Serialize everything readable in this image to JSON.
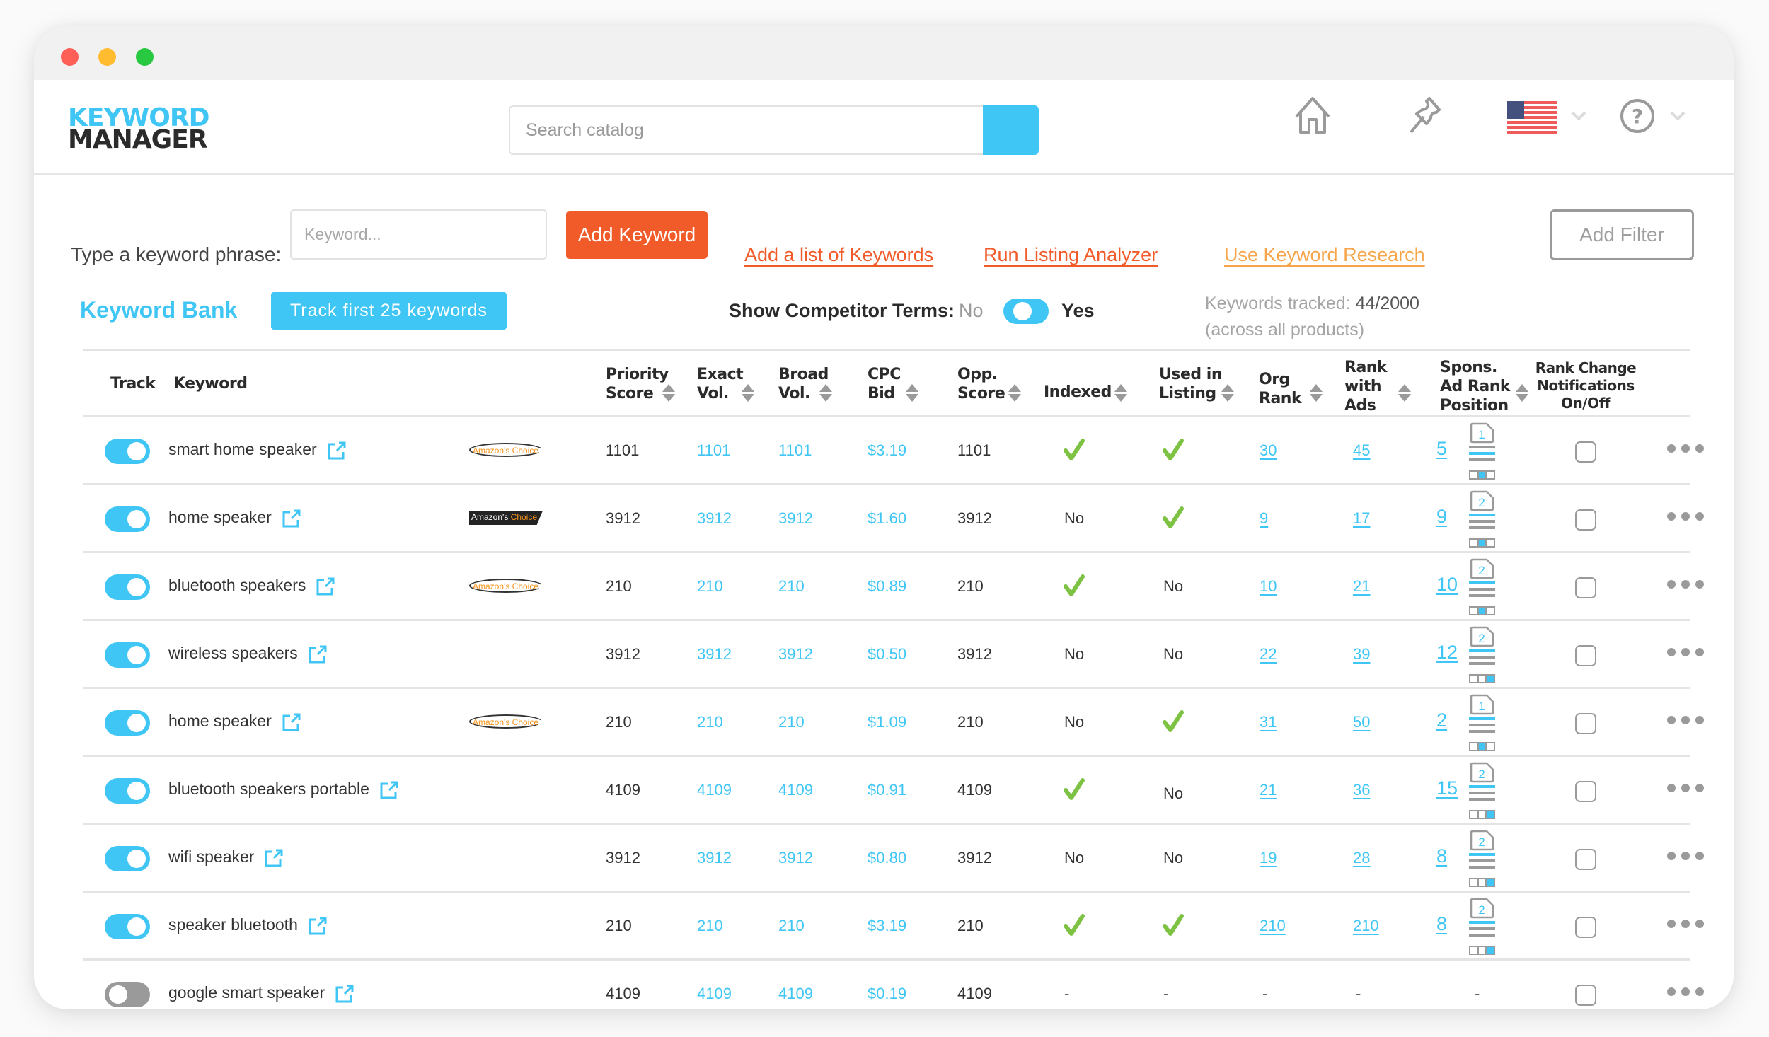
{
  "window": {
    "controls": [
      "close",
      "minimize",
      "maximize"
    ]
  },
  "header": {
    "logo_line1": "KEYWORD",
    "logo_line2": "MANAGER",
    "search_placeholder": "Search catalog",
    "icons": [
      "home-icon",
      "pin-icon",
      "us-flag-icon",
      "chevron-down-icon",
      "help-icon",
      "chevron-down-icon"
    ],
    "marketplace": "US"
  },
  "controls": {
    "keyword_phrase_label": "Type a keyword phrase:",
    "keyword_placeholder": "Keyword...",
    "add_keyword": "Add Keyword",
    "add_list": "Add a list of Keywords",
    "run_analyzer": "Run Listing Analyzer",
    "use_research": "Use Keyword Research",
    "add_filter": "Add Filter"
  },
  "bank": {
    "title": "Keyword Bank",
    "track_first": "Track first 25 keywords",
    "competitor_label": "Show Competitor Terms:",
    "competitor_no": "No",
    "competitor_yes": "Yes",
    "competitor_on": true,
    "tracked_label": "Keywords tracked:",
    "tracked_value": "44/2000",
    "tracked_note": "(across all products)"
  },
  "colors": {
    "accent": "#3fc6f4",
    "orange": "#f15a29",
    "check": "#7dc243",
    "muted": "#9a9a9a"
  },
  "table": {
    "headers": {
      "track": "Track",
      "keyword": "Keyword",
      "priority": [
        "Priority",
        "Score"
      ],
      "exact": [
        "Exact",
        "Vol."
      ],
      "broad": [
        "Broad",
        "Vol."
      ],
      "cpc": [
        "CPC",
        "Bid"
      ],
      "opp": [
        "Opp.",
        "Score"
      ],
      "indexed": "Indexed",
      "used": [
        "Used in",
        "Listing"
      ],
      "org": [
        "Org",
        "Rank"
      ],
      "rank_ads": [
        "Rank",
        "with",
        "Ads"
      ],
      "spons": [
        "Spons.",
        "Ad Rank",
        "Position"
      ],
      "notif": [
        "Rank Change",
        "Notifications",
        "On/Off"
      ]
    },
    "rows": [
      {
        "tracked": true,
        "keyword": "smart home speaker",
        "badge": "light",
        "priority": "1101",
        "exact": "1101",
        "broad": "1101",
        "cpc": "$3.19",
        "opp": "1101",
        "indexed": "check",
        "used": "check",
        "org": "30",
        "rank_ads": "45",
        "spons": "5",
        "ad_page": "1",
        "ad_line": 2,
        "ad_box": 2,
        "notify": false
      },
      {
        "tracked": true,
        "keyword": "home speaker",
        "badge": "dark",
        "priority": "3912",
        "exact": "3912",
        "broad": "3912",
        "cpc": "$1.60",
        "opp": "3912",
        "indexed": "No",
        "used": "check",
        "org": "9",
        "rank_ads": "17",
        "spons": "9",
        "ad_page": "2",
        "ad_line": 1,
        "ad_box": 2,
        "notify": false
      },
      {
        "tracked": true,
        "keyword": "bluetooth speakers",
        "badge": "light",
        "priority": "210",
        "exact": "210",
        "broad": "210",
        "cpc": "$0.89",
        "opp": "210",
        "indexed": "check",
        "used": "No",
        "org": "10",
        "rank_ads": "21",
        "spons": "10",
        "ad_page": "2",
        "ad_line": 1,
        "ad_box": 2,
        "notify": false
      },
      {
        "tracked": true,
        "keyword": "wireless speakers",
        "badge": "",
        "priority": "3912",
        "exact": "3912",
        "broad": "3912",
        "cpc": "$0.50",
        "opp": "3912",
        "indexed": "No",
        "used": "No",
        "org": "22",
        "rank_ads": "39",
        "spons": "12",
        "ad_page": "2",
        "ad_line": 1,
        "ad_box": 3,
        "notify": false
      },
      {
        "tracked": true,
        "keyword": "home speaker",
        "badge": "light",
        "priority": "210",
        "exact": "210",
        "broad": "210",
        "cpc": "$1.09",
        "opp": "210",
        "indexed": "No",
        "used": "check",
        "org": "31",
        "rank_ads": "50",
        "spons": "2",
        "ad_page": "1",
        "ad_line": 1,
        "ad_box": 2,
        "notify": false
      },
      {
        "tracked": true,
        "keyword": "bluetooth speakers portable",
        "badge": "",
        "priority": "4109",
        "exact": "4109",
        "broad": "4109",
        "cpc": "$0.91",
        "opp": "4109",
        "indexed": "check",
        "used": "No",
        "org": "21",
        "rank_ads": "36",
        "spons": "15",
        "ad_page": "2",
        "ad_line": 1,
        "ad_box": 3,
        "notify": false
      },
      {
        "tracked": true,
        "keyword": "wifi speaker",
        "badge": "",
        "priority": "3912",
        "exact": "3912",
        "broad": "3912",
        "cpc": "$0.80",
        "opp": "3912",
        "indexed": "No",
        "used": "No",
        "org": "19",
        "rank_ads": "28",
        "spons": "8",
        "ad_page": "2",
        "ad_line": 1,
        "ad_box": 3,
        "notify": false
      },
      {
        "tracked": true,
        "keyword": "speaker bluetooth",
        "badge": "",
        "priority": "210",
        "exact": "210",
        "broad": "210",
        "cpc": "$3.19",
        "opp": "210",
        "indexed": "check",
        "used": "check",
        "org": "210",
        "rank_ads": "210",
        "spons": "8",
        "ad_page": "2",
        "ad_line": 1,
        "ad_box": 3,
        "notify": false
      },
      {
        "tracked": false,
        "keyword": "google smart speaker",
        "badge": "",
        "priority": "4109",
        "exact": "4109",
        "broad": "4109",
        "cpc": "$0.19",
        "opp": "4109",
        "indexed": "-",
        "used": "-",
        "org": "-",
        "rank_ads": "-",
        "spons": "-",
        "ad_page": "",
        "ad_line": 0,
        "ad_box": 0,
        "notify": false
      }
    ],
    "badge_text_a": "Amazon's ",
    "badge_text_b": "Choice"
  }
}
